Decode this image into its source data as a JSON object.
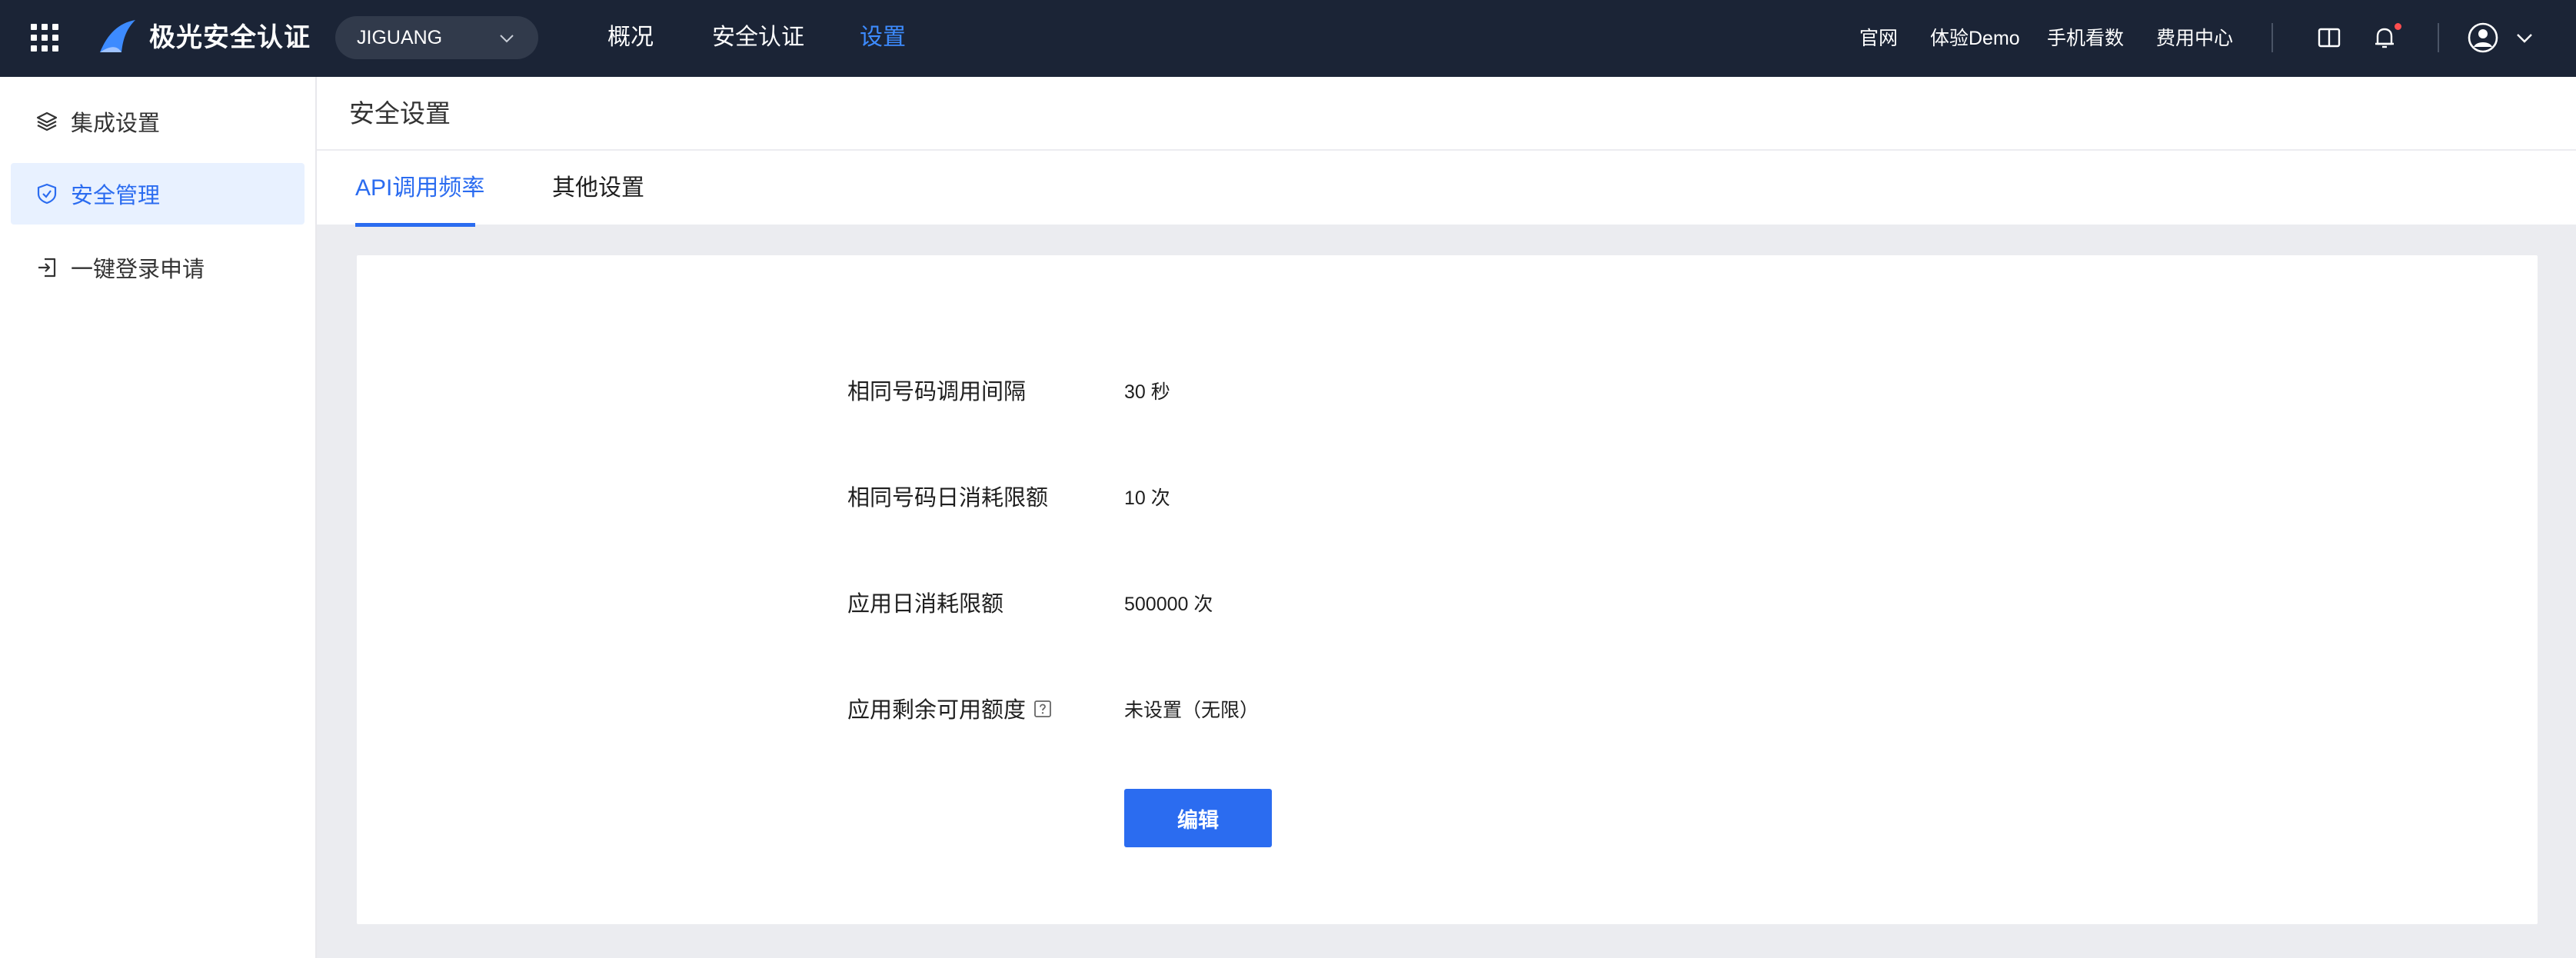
{
  "topbar": {
    "brand": "极光安全认证",
    "app_select": {
      "value": "JIGUANG"
    },
    "nav": [
      {
        "label": "概况"
      },
      {
        "label": "安全认证"
      },
      {
        "label": "设置"
      }
    ],
    "links": [
      {
        "label": "官网"
      },
      {
        "label": "体验Demo"
      },
      {
        "label": "手机看数"
      },
      {
        "label": "费用中心"
      }
    ],
    "icons": [
      "apps-grid-icon",
      "logo-icon",
      "docs-book-icon",
      "bell-icon",
      "user-avatar-icon",
      "chevron-down-icon"
    ],
    "colors": {
      "bg": "#1b2436",
      "active": "#3d8bff"
    }
  },
  "sidebar": {
    "items": [
      {
        "label": "集成设置",
        "icon": "layers-icon"
      },
      {
        "label": "安全管理",
        "icon": "shield-icon"
      },
      {
        "label": "一键登录申请",
        "icon": "login-icon"
      }
    ]
  },
  "main": {
    "title": "安全设置",
    "tabs": [
      {
        "label": "API调用频率"
      },
      {
        "label": "其他设置"
      }
    ],
    "fields": [
      {
        "label": "相同号码调用间隔",
        "value": "30 秒"
      },
      {
        "label": "相同号码日消耗限额",
        "value": "10 次"
      },
      {
        "label": "应用日消耗限额",
        "value": "500000 次"
      },
      {
        "label": "应用剩余可用额度",
        "value": "未设置（无限）"
      }
    ],
    "edit_label": "编辑",
    "colors": {
      "primary": "#2b6cf0",
      "active_bg": "#e8f1ff"
    }
  }
}
